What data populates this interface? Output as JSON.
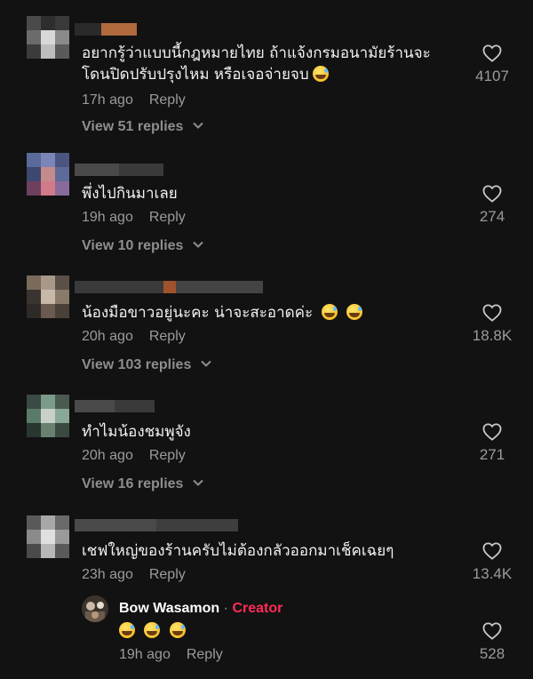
{
  "comments": [
    {
      "text": "อยากรู้ว่าแบบนี้กฎหมายไทย ถ้าแจ้งกรมอนามัยร้านจะ",
      "text2": "โดนปิดปรับปรุงไหม หรือเจอจ่ายจบ",
      "time": "17h ago",
      "reply_label": "Reply",
      "view_replies": "View 51 replies",
      "likes": "4107"
    },
    {
      "text": "พึ่งไปกินมาเลย",
      "time": "19h ago",
      "reply_label": "Reply",
      "view_replies": "View 10 replies",
      "likes": "274"
    },
    {
      "text": "น้องมือขาวอยู่นะคะ น่าจะสะอาดค่ะ",
      "time": "20h ago",
      "reply_label": "Reply",
      "view_replies": "View 103 replies",
      "likes": "18.8K"
    },
    {
      "text": "ทำไมน้องชมพูจัง",
      "time": "20h ago",
      "reply_label": "Reply",
      "view_replies": "View 16 replies",
      "likes": "271"
    },
    {
      "text": "เชฟใหญ่ของร้านครับไม่ต้องกลัวออกมาเช็คเฉยๆ",
      "time": "23h ago",
      "reply_label": "Reply",
      "likes": "13.4K"
    }
  ],
  "creator_reply": {
    "name": "Bow Wasamon",
    "separator": "·",
    "badge": "Creator",
    "time": "19h ago",
    "reply_label": "Reply",
    "likes": "528"
  },
  "colors": {
    "background": "#121212",
    "muted_text": "#9b9b9b",
    "creator_badge": "#fe2c55"
  },
  "icons": [
    "heart-outline-icon",
    "chevron-down-icon",
    "grinning-sweat-emoji",
    "tears-of-joy-emoji"
  ]
}
